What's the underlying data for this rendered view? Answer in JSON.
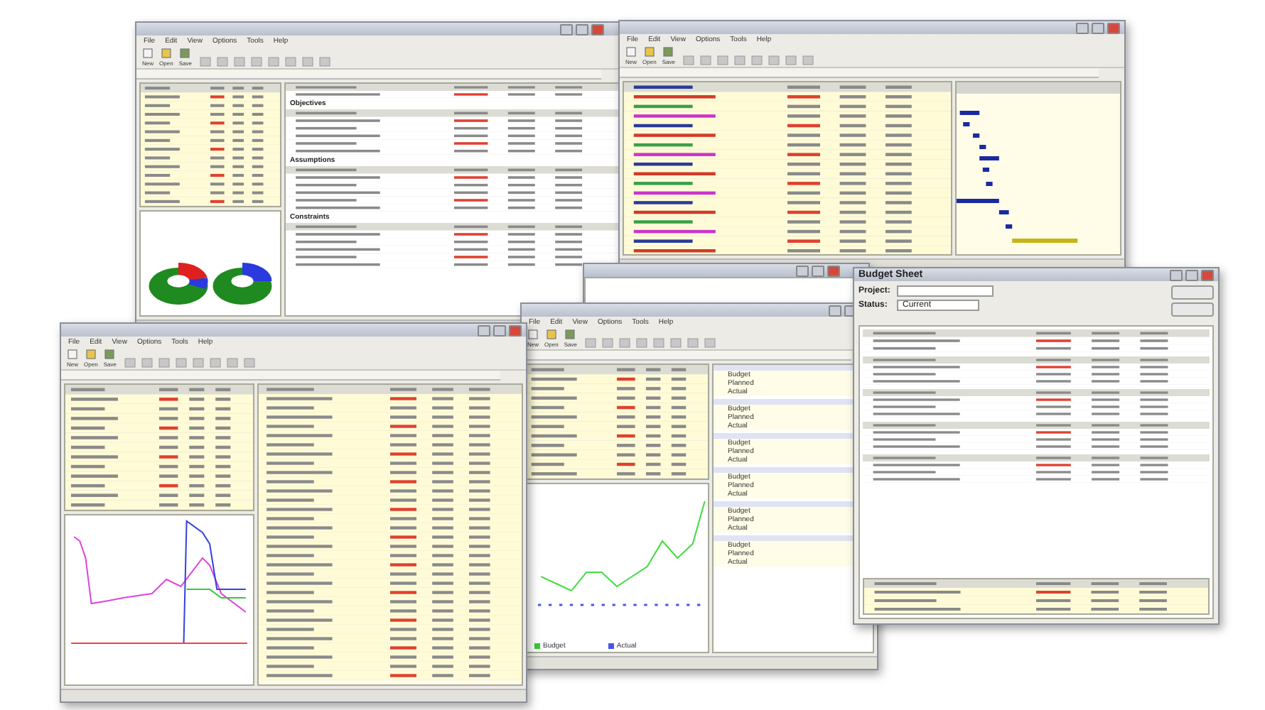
{
  "windows": [
    {
      "kind": "project",
      "menu": [
        "File",
        "Edit",
        "View",
        "Options",
        "Tools",
        "Help"
      ],
      "toolbar": [
        "New",
        "Open",
        "Save"
      ],
      "sections": [
        "Objectives",
        "Assumptions",
        "Constraints"
      ]
    },
    {
      "kind": "gantt",
      "menu": [
        "File",
        "Edit",
        "View",
        "Options",
        "Tools",
        "Help"
      ],
      "toolbar": [
        "New",
        "Open",
        "Save"
      ]
    },
    {
      "kind": "trend"
    },
    {
      "kind": "budget",
      "menu": [
        "File",
        "Edit",
        "View",
        "Options",
        "Tools",
        "Help"
      ],
      "toolbar": [
        "New",
        "Open",
        "Save"
      ],
      "legend": [
        "Budget",
        "Actual"
      ],
      "groups": [
        {
          "rows": [
            "Budget",
            "Planned",
            "Actual"
          ]
        },
        {
          "rows": [
            "Budget",
            "Planned",
            "Actual"
          ]
        },
        {
          "rows": [
            "Budget",
            "Planned",
            "Actual"
          ]
        },
        {
          "rows": [
            "Budget",
            "Planned",
            "Actual"
          ]
        },
        {
          "rows": [
            "Budget",
            "Planned",
            "Actual"
          ]
        },
        {
          "rows": [
            "Budget",
            "Planned",
            "Actual"
          ]
        }
      ]
    },
    {
      "kind": "metrics",
      "menu": [
        "File",
        "Edit",
        "View",
        "Options",
        "Tools",
        "Help"
      ],
      "toolbar": [
        "New",
        "Open",
        "Save"
      ]
    },
    {
      "kind": "sheet",
      "title": "Budget Sheet",
      "project_label": "Project:",
      "status_label": "Status:",
      "status_value": "Current"
    }
  ]
}
